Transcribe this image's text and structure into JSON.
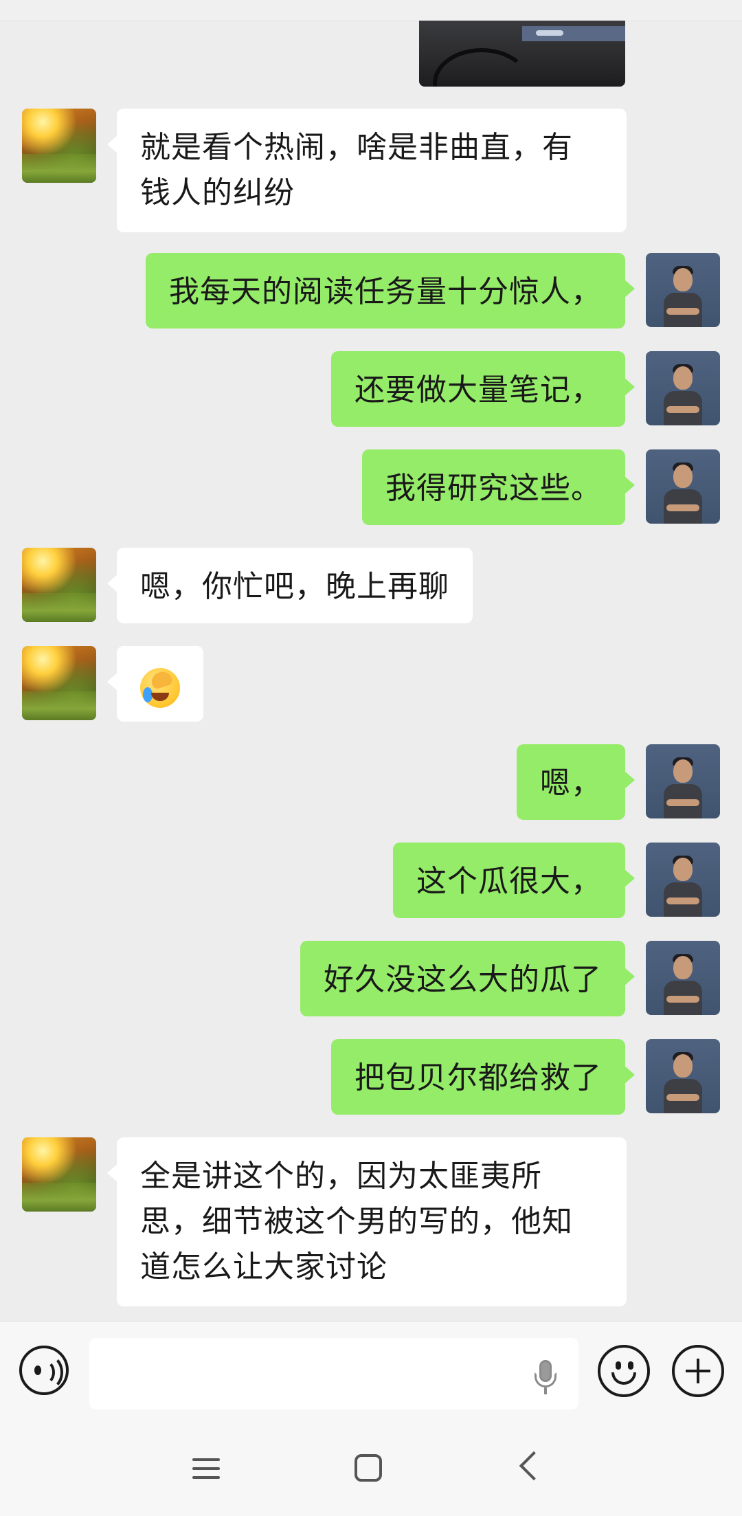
{
  "conversation": {
    "messages": [
      {
        "side": "in",
        "text": "就是看个热闹，啥是非曲直，有钱人的纠纷"
      },
      {
        "side": "out",
        "text": "我每天的阅读任务量十分惊人，"
      },
      {
        "side": "out",
        "text": "还要做大量笔记，"
      },
      {
        "side": "out",
        "text": "我得研究这些。"
      },
      {
        "side": "in",
        "text": "嗯，你忙吧，晚上再聊"
      },
      {
        "side": "in",
        "emoji": "facepalm-laughing-emoji"
      },
      {
        "side": "out",
        "text": "嗯，"
      },
      {
        "side": "out",
        "text": "这个瓜很大，"
      },
      {
        "side": "out",
        "text": "好久没这么大的瓜了"
      },
      {
        "side": "out",
        "text": "把包贝尔都给救了"
      },
      {
        "side": "in",
        "text": "全是讲这个的，因为太匪夷所思，细节被这个男的写的，他知道怎么让大家讨论"
      }
    ]
  },
  "input_bar": {
    "placeholder": "",
    "icons": [
      "voice-icon",
      "microphone-icon",
      "emoji-icon",
      "plus-icon"
    ]
  },
  "nav_bar": {
    "icons": [
      "menu-icon",
      "home-icon",
      "back-icon"
    ]
  },
  "colors": {
    "background": "#ededed",
    "incoming_bubble": "#ffffff",
    "outgoing_bubble": "#95ec69"
  }
}
